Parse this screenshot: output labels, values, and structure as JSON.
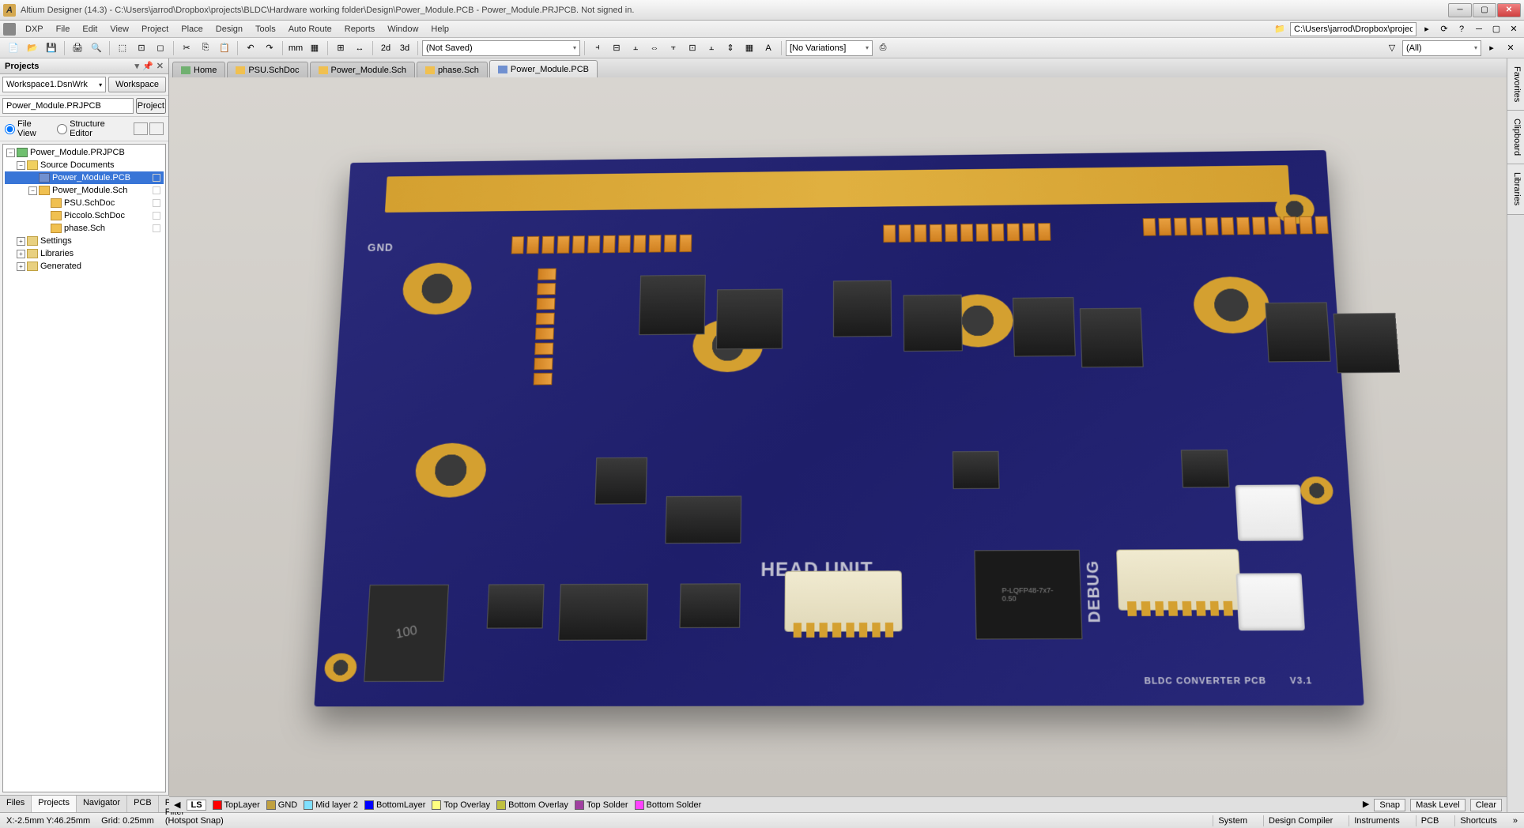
{
  "titlebar": {
    "app_letter": "A",
    "title": "Altium Designer (14.3) - C:\\Users\\jarrod\\Dropbox\\projects\\BLDC\\Hardware working folder\\Design\\Power_Module.PCB - Power_Module.PRJPCB. Not signed in."
  },
  "menu": {
    "dxp": "DXP",
    "file": "File",
    "edit": "Edit",
    "view": "View",
    "project": "Project",
    "place": "Place",
    "design": "Design",
    "tools": "Tools",
    "autoroute": "Auto Route",
    "reports": "Reports",
    "window": "Window",
    "help": "Help",
    "path_field": "C:\\Users\\jarrod\\Dropbox\\projects\\"
  },
  "toolbar": {
    "saved_combo": "(Not Saved)",
    "variation_combo": "[No Variations]",
    "filter_combo": "(All)"
  },
  "projects_panel": {
    "title": "Projects",
    "workspace": "Workspace1.DsnWrk",
    "workspace_btn": "Workspace",
    "project_field": "Power_Module.PRJPCB",
    "project_btn": "Project",
    "file_view": "File View",
    "structure_editor": "Structure Editor",
    "tree": {
      "root": "Power_Module.PRJPCB",
      "source_docs": "Source Documents",
      "pcb": "Power_Module.PCB",
      "sch_main": "Power_Module.Sch",
      "sch_psu": "PSU.SchDoc",
      "sch_piccolo": "Piccolo.SchDoc",
      "sch_phase": "phase.Sch",
      "settings": "Settings",
      "libraries": "Libraries",
      "generated": "Generated"
    }
  },
  "left_tabs": {
    "files": "Files",
    "projects": "Projects",
    "navigator": "Navigator",
    "pcb": "PCB",
    "pcb_filter": "PCB Filter"
  },
  "editor_tabs": {
    "home": "Home",
    "psu": "PSU.SchDoc",
    "pm_sch": "Power_Module.Sch",
    "phase": "phase.Sch",
    "pm_pcb": "Power_Module.PCB"
  },
  "pcb_silkscreen": {
    "gnd": "GND",
    "head_unit": "HEAD UNIT",
    "debug": "DEBUG",
    "title": "BLDC CONVERTER PCB",
    "version": "V3.1",
    "lqfp_pkg": "P-LQFP48-7x7-0.50",
    "inductor": "100"
  },
  "layers": {
    "strip_label": "LS",
    "top": "TopLayer",
    "gnd": "GND",
    "mid": "Mid layer 2",
    "bottom": "BottomLayer",
    "top_ov": "Top Overlay",
    "bot_ov": "Bottom Overlay",
    "top_sold": "Top Solder",
    "bot_sold": "Bottom Solder",
    "snap": "Snap",
    "mask": "Mask Level",
    "clear": "Clear",
    "colors": {
      "top": "#ff0000",
      "gnd": "#c0a040",
      "mid": "#80e0ff",
      "bottom": "#0000ff",
      "top_ov": "#ffff80",
      "bot_ov": "#c0c040",
      "top_sold": "#a040a0",
      "bot_sold": "#ff40ff"
    }
  },
  "right_tabs": {
    "fav": "Favorites",
    "clip": "Clipboard",
    "lib": "Libraries"
  },
  "statusbar": {
    "coords": "X:-2.5mm Y:46.25mm",
    "grid": "Grid: 0.25mm",
    "hotspot": "(Hotspot Snap)",
    "system": "System",
    "design_compiler": "Design Compiler",
    "instruments": "Instruments",
    "pcb": "PCB",
    "shortcuts": "Shortcuts"
  }
}
